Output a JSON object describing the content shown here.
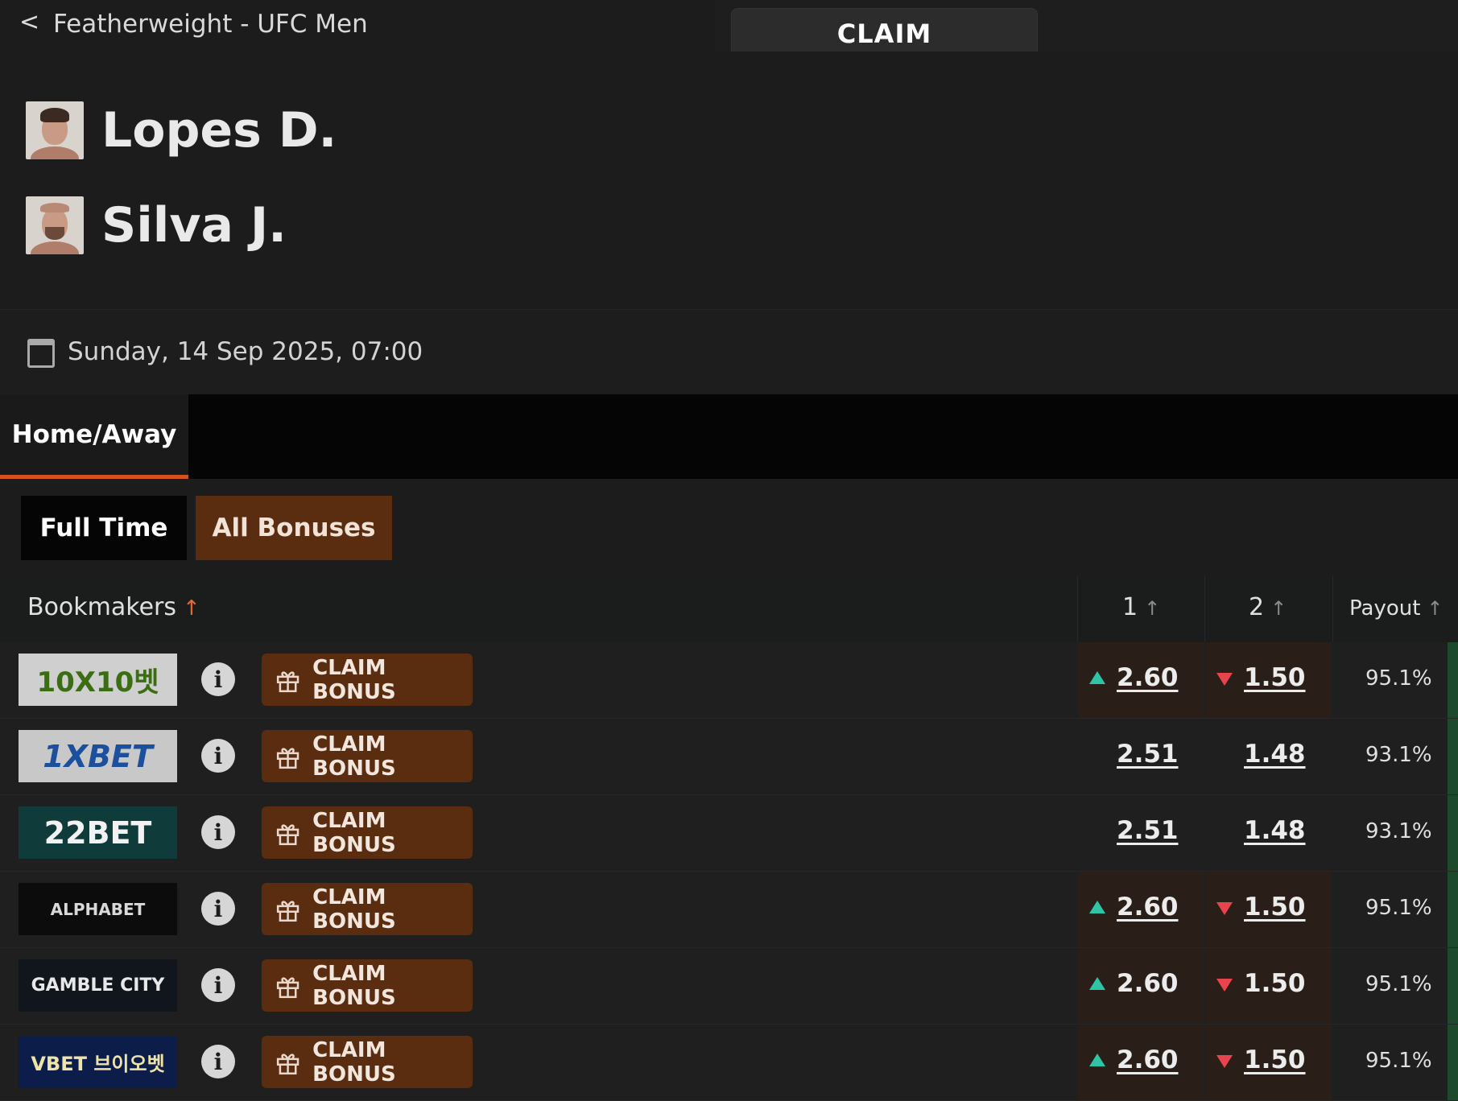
{
  "topbar": {
    "back": "<",
    "breadcrumb": "Featherweight - UFC Men",
    "claim_label": "CLAIM"
  },
  "players": [
    {
      "name": "Lopes D."
    },
    {
      "name": "Silva J."
    }
  ],
  "event": {
    "date": "Sunday, 14 Sep 2025, 07:00"
  },
  "tabs": [
    {
      "label": "Home/Away",
      "active": true
    }
  ],
  "filters": {
    "full_time": "Full Time",
    "all_bonuses": "All Bonuses"
  },
  "table": {
    "headers": {
      "bookmakers": "Bookmakers",
      "col1": "1",
      "col2": "2",
      "payout": "Payout"
    },
    "colors": {
      "up": "#2fc4a6",
      "down": "#e8444d",
      "claim_bg": "#5a2c10",
      "active_tab_underline": "#d2511d"
    },
    "rows": [
      {
        "bookmaker": "10X10벳",
        "info": "i",
        "claim": "CLAIM BONUS",
        "odd1": "2.60",
        "odd2": "1.50",
        "payout": "95.1%",
        "trend1": "up",
        "trend2": "down"
      },
      {
        "bookmaker": "1XBET",
        "info": "i",
        "claim": "CLAIM BONUS",
        "odd1": "2.51",
        "odd2": "1.48",
        "payout": "93.1%",
        "trend1": "none",
        "trend2": "none"
      },
      {
        "bookmaker": "22BET",
        "info": "i",
        "claim": "CLAIM BONUS",
        "odd1": "2.51",
        "odd2": "1.48",
        "payout": "93.1%",
        "trend1": "none",
        "trend2": "none"
      },
      {
        "bookmaker": "ALPHABET",
        "info": "i",
        "claim": "CLAIM BONUS",
        "odd1": "2.60",
        "odd2": "1.50",
        "payout": "95.1%",
        "trend1": "up",
        "trend2": "down"
      },
      {
        "bookmaker": "GAMBLE CITY",
        "info": "i",
        "claim": "CLAIM BONUS",
        "odd1": "2.60",
        "odd2": "1.50",
        "payout": "95.1%",
        "trend1": "up",
        "trend2": "down"
      },
      {
        "bookmaker": "VBET 브이오벳",
        "info": "i",
        "claim": "CLAIM BONUS",
        "odd1": "2.60",
        "odd2": "1.50",
        "payout": "95.1%",
        "trend1": "up",
        "trend2": "down"
      }
    ]
  }
}
